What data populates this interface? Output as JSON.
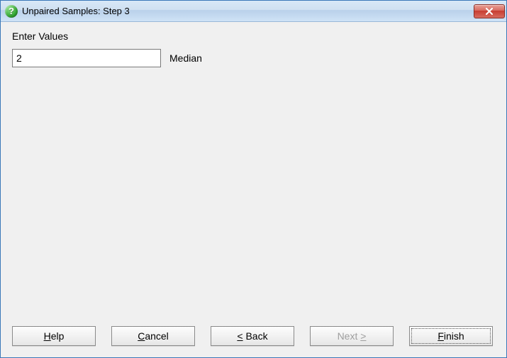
{
  "title": "Unpaired Samples: Step 3",
  "prompt": "Enter Values",
  "input": {
    "value": "2",
    "label": "Median"
  },
  "buttons": {
    "help": {
      "pre": "",
      "u": "H",
      "post": "elp"
    },
    "cancel": {
      "pre": "",
      "u": "C",
      "post": "ancel"
    },
    "back": {
      "pre": "",
      "u": "<",
      "post": " Back"
    },
    "next": {
      "pre": "Next ",
      "u": ">",
      "post": ""
    },
    "finish": {
      "pre": "",
      "u": "F",
      "post": "inish"
    }
  }
}
